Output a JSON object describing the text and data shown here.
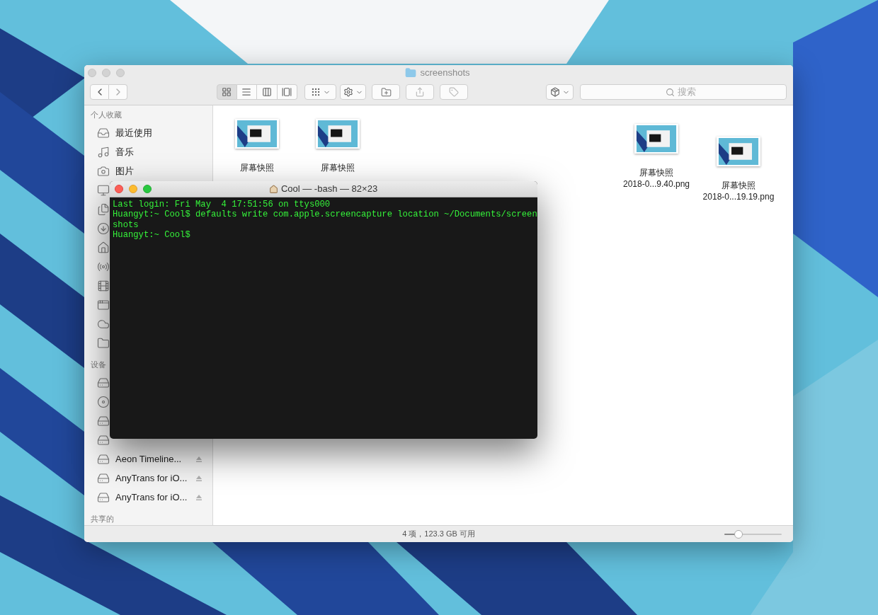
{
  "finder": {
    "title": "screenshots",
    "view_modes": [
      {
        "selected": true
      },
      {
        "selected": false
      },
      {
        "selected": false
      },
      {
        "selected": false
      }
    ],
    "search": {
      "placeholder": "搜索"
    },
    "sidebar": {
      "sections": [
        {
          "heading": "个人收藏",
          "items": [
            {
              "label": "最近使用"
            },
            {
              "label": "音乐"
            },
            {
              "label": "图片"
            }
          ]
        },
        {
          "heading": "设备",
          "items": [
            {
              "label": "Aeon Timeline...",
              "ejectable": true
            },
            {
              "label": "AnyTrans for iO...",
              "ejectable": true
            },
            {
              "label": "AnyTrans for iO...",
              "ejectable": true
            }
          ]
        },
        {
          "heading": "共享的"
        }
      ]
    },
    "files": [
      {
        "name": "屏幕快照"
      },
      {
        "name": "屏幕快照"
      },
      {
        "name": "屏幕快照",
        "filename": "2018-0...9.40.png"
      },
      {
        "name": "屏幕快照",
        "filename": "2018-0...19.19.png"
      }
    ],
    "status_bar": {
      "text": "4 项，123.3 GB 可用",
      "zoom": {
        "level": 0.25
      }
    }
  },
  "terminal": {
    "title": "Cool — -bash — 82×23",
    "lines": [
      "Last login: Fri May  4 17:51:56 on ttys000",
      "Huangyt:~ Cool$ defaults write com.apple.screencapture location ~/Documents/screen",
      "shots",
      "Huangyt:~ Cool$"
    ]
  }
}
